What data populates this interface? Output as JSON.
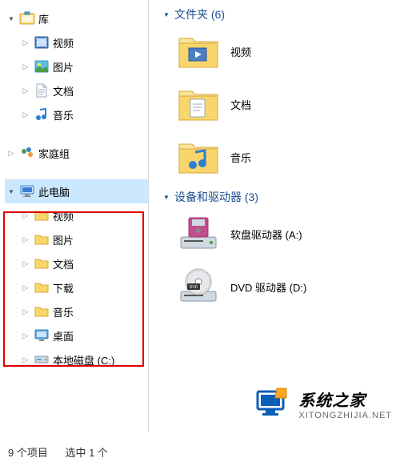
{
  "sidebar": {
    "library": {
      "label": "库",
      "items": [
        {
          "label": "视频"
        },
        {
          "label": "图片"
        },
        {
          "label": "文档"
        },
        {
          "label": "音乐"
        }
      ]
    },
    "homegroup": {
      "label": "家庭组"
    },
    "thispc": {
      "label": "此电脑",
      "items": [
        {
          "label": "视频"
        },
        {
          "label": "图片"
        },
        {
          "label": "文档"
        },
        {
          "label": "下载"
        },
        {
          "label": "音乐"
        }
      ]
    },
    "desktop": {
      "label": "桌面"
    },
    "localdisk": {
      "label": "本地磁盘 (C:)"
    }
  },
  "content": {
    "folders": {
      "header": "文件夹 (6)",
      "items": [
        {
          "label": "视频"
        },
        {
          "label": "文档"
        },
        {
          "label": "音乐"
        }
      ]
    },
    "devices": {
      "header": "设备和驱动器 (3)",
      "items": [
        {
          "label": "软盘驱动器 (A:)"
        },
        {
          "label": "DVD 驱动器 (D:)"
        }
      ]
    }
  },
  "statusbar": {
    "items": "9 个项目",
    "selected": "选中 1 个"
  },
  "watermark": {
    "title": "系统之家",
    "sub": "XITONGZHIJIA.NET"
  }
}
